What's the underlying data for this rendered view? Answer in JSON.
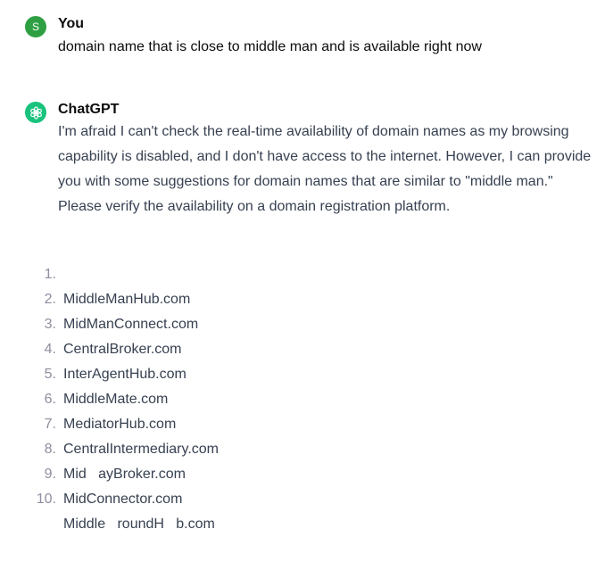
{
  "conversation": {
    "user": {
      "avatar_letter": "S",
      "author": "You",
      "message": "domain name that is close to middle man and is available right now"
    },
    "assistant": {
      "avatar_icon": "openai-logo-icon",
      "author": "ChatGPT",
      "paragraph": "I'm afraid I can't check the real-time availability of domain names as my browsing capability is disabled, and I don't have access to the internet. However, I can provide you with some suggestions for domain names that are similar to \"middle man.\" Please verify the availability on a domain registration platform.",
      "list": [
        {
          "num": "1.",
          "text": "MiddleManHub.com"
        },
        {
          "num": "2.",
          "text": "MidManConnect.com"
        },
        {
          "num": "3.",
          "text": "CentralBroker.com"
        },
        {
          "num": "4.",
          "text": "InterAgentHub.com"
        },
        {
          "num": "5.",
          "text": "MiddleMate.com"
        },
        {
          "num": "6.",
          "text": "MediatorHub.com"
        },
        {
          "num": "7.",
          "text": "CentralIntermediary.com"
        },
        {
          "num": "8.",
          "text": "Mid   ayBroker.com"
        },
        {
          "num": "9.",
          "text": "MidConnector.com"
        },
        {
          "num": "10.",
          "text": "Middle   roundH   b.com"
        }
      ]
    }
  },
  "colors": {
    "user_avatar": "#2ea043",
    "assistant_avatar": "#19c37d",
    "assistant_text": "#374151",
    "list_number": "#8e8ea0"
  }
}
